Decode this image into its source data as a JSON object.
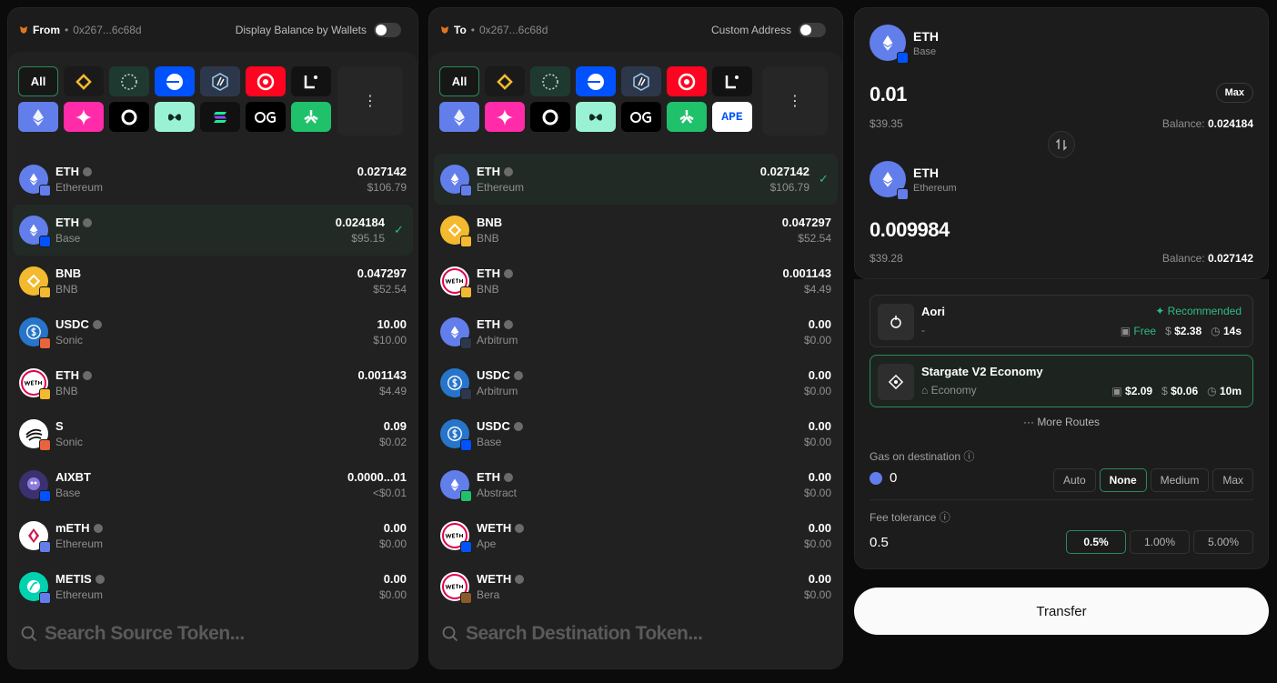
{
  "from_panel": {
    "label": "From",
    "address": "0x267...6c68d",
    "toggle_label": "Display Balance by Wallets",
    "chain_all_label": "All",
    "more_label": "⋮",
    "search_placeholder": "Search Source Token...",
    "tokens": [
      {
        "symbol": "ETH",
        "chain": "Ethereum",
        "amount": "0.027142",
        "usd": "$106.79"
      },
      {
        "symbol": "ETH",
        "chain": "Base",
        "amount": "0.024184",
        "usd": "$95.15"
      },
      {
        "symbol": "BNB",
        "chain": "BNB",
        "amount": "0.047297",
        "usd": "$52.54"
      },
      {
        "symbol": "USDC",
        "chain": "Sonic",
        "amount": "10.00",
        "usd": "$10.00"
      },
      {
        "symbol": "ETH",
        "chain": "BNB",
        "amount": "0.001143",
        "usd": "$4.49"
      },
      {
        "symbol": "S",
        "chain": "Sonic",
        "amount": "0.09",
        "usd": "$0.02"
      },
      {
        "symbol": "AIXBT",
        "chain": "Base",
        "amount": "0.0000...01",
        "usd": "<$0.01"
      },
      {
        "symbol": "mETH",
        "chain": "Ethereum",
        "amount": "0.00",
        "usd": "$0.00"
      },
      {
        "symbol": "METIS",
        "chain": "Ethereum",
        "amount": "0.00",
        "usd": "$0.00"
      }
    ]
  },
  "to_panel": {
    "label": "To",
    "address": "0x267...6c68d",
    "toggle_label": "Custom Address",
    "chain_all_label": "All",
    "ape_label": "APE",
    "more_label": "⋮",
    "search_placeholder": "Search Destination Token...",
    "tokens": [
      {
        "symbol": "ETH",
        "chain": "Ethereum",
        "amount": "0.027142",
        "usd": "$106.79"
      },
      {
        "symbol": "BNB",
        "chain": "BNB",
        "amount": "0.047297",
        "usd": "$52.54"
      },
      {
        "symbol": "ETH",
        "chain": "BNB",
        "amount": "0.001143",
        "usd": "$4.49"
      },
      {
        "symbol": "ETH",
        "chain": "Arbitrum",
        "amount": "0.00",
        "usd": "$0.00"
      },
      {
        "symbol": "USDC",
        "chain": "Arbitrum",
        "amount": "0.00",
        "usd": "$0.00"
      },
      {
        "symbol": "USDC",
        "chain": "Base",
        "amount": "0.00",
        "usd": "$0.00"
      },
      {
        "symbol": "ETH",
        "chain": "Abstract",
        "amount": "0.00",
        "usd": "$0.00"
      },
      {
        "symbol": "WETH",
        "chain": "Ape",
        "amount": "0.00",
        "usd": "$0.00"
      },
      {
        "symbol": "WETH",
        "chain": "Bera",
        "amount": "0.00",
        "usd": "$0.00"
      }
    ]
  },
  "swap": {
    "from": {
      "symbol": "ETH",
      "chain": "Base",
      "amount": "0.01",
      "usd": "$39.35",
      "balance_label": "Balance:",
      "balance": "0.024184",
      "max_label": "Max"
    },
    "to": {
      "symbol": "ETH",
      "chain": "Ethereum",
      "amount": "0.009984",
      "usd": "$39.28",
      "balance_label": "Balance:",
      "balance": "0.027142"
    }
  },
  "routes": [
    {
      "name": "Aori",
      "sub": "-",
      "tag": "Recommended",
      "fee": "Free",
      "cost": "$2.38",
      "time": "14s"
    },
    {
      "name": "Stargate V2 Economy",
      "sub": "Economy",
      "fee": "$2.09",
      "cost": "$0.06",
      "time": "10m"
    }
  ],
  "more_routes_label": "More Routes",
  "gas": {
    "label": "Gas on destination",
    "value": "0",
    "options": [
      "Auto",
      "None",
      "Medium",
      "Max"
    ],
    "selected": "None"
  },
  "fee": {
    "label": "Fee tolerance",
    "value": "0.5",
    "options": [
      "0.5%",
      "1.00%",
      "5.00%"
    ],
    "selected": "0.5%"
  },
  "transfer_label": "Transfer",
  "colors": {
    "accent": "#2ebd85",
    "eth": "#627eea",
    "bnb": "#f3ba2f",
    "usdc": "#2775ca",
    "base": "#0052ff"
  }
}
